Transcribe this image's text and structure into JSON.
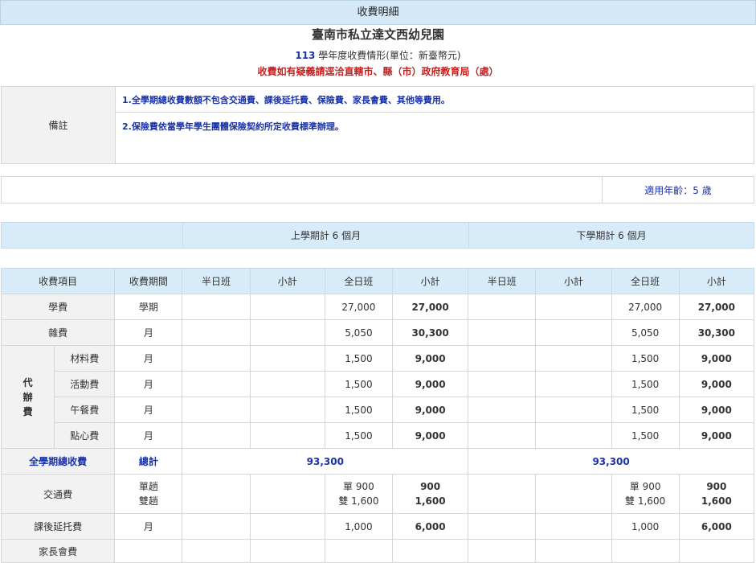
{
  "header": {
    "title": "收費明細",
    "school": "臺南市私立達文西幼兒園",
    "year": "113",
    "year_suffix": "學年度收費情形(單位：新臺幣元)",
    "contact": "收費如有疑義請逕洽直轄市、縣（市）政府教育局（處）"
  },
  "notes": {
    "label": "備註",
    "items": [
      "1.全學期總收費數額不包含交通費、課後延托費、保險費、家長會費、其他等費用。",
      "2.保險費依當學年學生團體保險契約所定收費標準辦理。"
    ]
  },
  "age": {
    "label": "適用年齡：5 歲"
  },
  "semesters": {
    "first": "上學期計 6 個月",
    "second": "下學期計 6 個月"
  },
  "fees": {
    "columns": [
      "收費項目",
      "收費期間",
      "半日班",
      "小計",
      "全日班",
      "小計",
      "半日班",
      "小計",
      "全日班",
      "小計"
    ],
    "tuition": {
      "name": "學費",
      "period": "學期",
      "s1_full": "27,000",
      "s1_sub": "27,000",
      "s2_full": "27,000",
      "s2_sub": "27,000"
    },
    "misc": {
      "name": "雜費",
      "period": "月",
      "s1_full": "5,050",
      "s1_sub": "30,300",
      "s2_full": "5,050",
      "s2_sub": "30,300"
    },
    "agency_label": [
      "代",
      "辦",
      "費"
    ],
    "agency": [
      {
        "name": "材料費",
        "period": "月",
        "s1_full": "1,500",
        "s1_sub": "9,000",
        "s2_full": "1,500",
        "s2_sub": "9,000"
      },
      {
        "name": "活動費",
        "period": "月",
        "s1_full": "1,500",
        "s1_sub": "9,000",
        "s2_full": "1,500",
        "s2_sub": "9,000"
      },
      {
        "name": "午餐費",
        "period": "月",
        "s1_full": "1,500",
        "s1_sub": "9,000",
        "s2_full": "1,500",
        "s2_sub": "9,000"
      },
      {
        "name": "點心費",
        "period": "月",
        "s1_full": "1,500",
        "s1_sub": "9,000",
        "s2_full": "1,500",
        "s2_sub": "9,000"
      }
    ],
    "total": {
      "name": "全學期總收費",
      "period": "總計",
      "s1": "93,300",
      "s2": "93,300"
    },
    "transport": {
      "name": "交通費",
      "period1": "單趟",
      "period2": "雙趟",
      "s1_full1": "單 900",
      "s1_full2": "雙 1,600",
      "s1_sub1": "900",
      "s1_sub2": "1,600",
      "s2_full1": "單 900",
      "s2_full2": "雙 1,600",
      "s2_sub1": "900",
      "s2_sub2": "1,600"
    },
    "aftercare": {
      "name": "課後延托費",
      "period": "月",
      "s1_full": "1,000",
      "s1_sub": "6,000",
      "s2_full": "1,000",
      "s2_sub": "6,000"
    },
    "parents": {
      "name": "家長會費"
    }
  }
}
